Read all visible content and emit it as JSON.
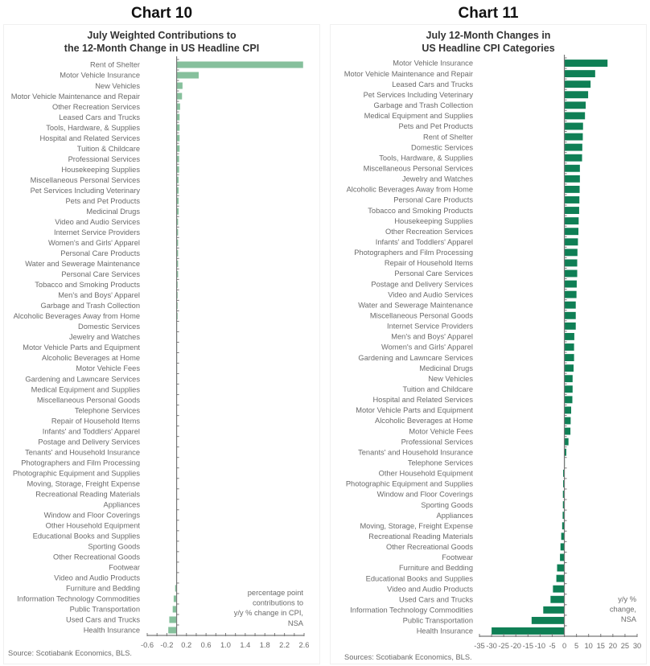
{
  "chart_data": [
    {
      "id": "chart10",
      "chart_number": "Chart 10",
      "type": "bar",
      "orientation": "horizontal",
      "title": "July Weighted Contributions to the 12-Month Change in US Headline CPI",
      "title_lines": [
        "July Weighted Contributions to",
        "the 12-Month Change in US Headline CPI"
      ],
      "note_lines": [
        "percentage point",
        "contributions to",
        "y/y % change in CPI,",
        "NSA"
      ],
      "source": "Source: Scotiabank Economics, BLS.",
      "xlim": [
        -0.6,
        2.6
      ],
      "xticks": [
        -0.6,
        -0.2,
        0.2,
        0.6,
        1.0,
        1.4,
        1.8,
        2.2,
        2.6
      ],
      "xtick_labels": [
        "-0.6",
        "-0.2",
        "0.2",
        "0.6",
        "1.0",
        "1.4",
        "1.8",
        "2.2",
        "2.6"
      ],
      "minor_tick_step": 0.2,
      "bar_color": "#86c09c",
      "categories": [
        "Rent of Shelter",
        "Motor Vehicle Insurance",
        "New Vehicles",
        "Motor Vehicle Maintenance and Repair",
        "Other Recreation Services",
        "Leased Cars and Trucks",
        "Tools, Hardware, & Supplies",
        "Hospital and Related Services",
        "Tuition & Childcare",
        "Professional Services",
        "Housekeeping Supplies",
        "Miscellaneous Personal Services",
        "Pet Services Including Veterinary",
        "Pets and Pet Products",
        "Medicinal Drugs",
        "Video and Audio Services",
        "Internet Service Providers",
        "Women's and Girls' Apparel",
        "Personal Care Products",
        "Water and Sewerage Maintenance",
        "Personal Care Services",
        "Tobacco and Smoking Products",
        "Men's and Boys' Apparel",
        "Garbage and Trash Collection",
        "Alcoholic Beverages Away from Home",
        "Domestic Services",
        "Jewelry and Watches",
        "Motor Vehicle Parts and Equipment",
        "Alcoholic Beverages at Home",
        "Motor Vehicle Fees",
        "Gardening and Lawncare Services",
        "Medical Equipment and Supplies",
        "Miscellaneous Personal Goods",
        "Telephone Services",
        "Repair of Household Items",
        "Infants' and Toddlers' Apparel",
        "Postage and Delivery Services",
        "Tenants' and Household Insurance",
        "Photographers and Film Processing",
        "Photographic Equipment and Supplies",
        "Moving, Storage, Freight Expense",
        "Recreational Reading Materials",
        "Appliances",
        "Window and Floor Coverings",
        "Other Household Equipment",
        "Educational Books and Supplies",
        "Sporting Goods",
        "Other Recreational Goods",
        "Footwear",
        "Video and Audio Products",
        "Furniture and Bedding",
        "Information Technology Commodities",
        "Public Transportation",
        "Used Cars and Trucks",
        "Health Insurance"
      ],
      "values": [
        2.58,
        0.45,
        0.12,
        0.11,
        0.07,
        0.06,
        0.06,
        0.06,
        0.06,
        0.05,
        0.05,
        0.04,
        0.04,
        0.04,
        0.04,
        0.03,
        0.03,
        0.03,
        0.03,
        0.03,
        0.03,
        0.02,
        0.02,
        0.02,
        0.02,
        0.01,
        0.01,
        0.01,
        0.01,
        0.01,
        0.01,
        0.01,
        0.005,
        0.005,
        0.005,
        0.005,
        0.005,
        0.003,
        0.002,
        0.0,
        0.0,
        0.0,
        0.0,
        0.0,
        0.0,
        -0.002,
        -0.003,
        -0.004,
        -0.005,
        -0.01,
        -0.03,
        -0.06,
        -0.08,
        -0.15,
        -0.17
      ]
    },
    {
      "id": "chart11",
      "chart_number": "Chart 11",
      "type": "bar",
      "orientation": "horizontal",
      "title": "July 12-Month Changes in US Headline CPI Categories",
      "title_lines": [
        "July 12-Month Changes in",
        "US Headline CPI Categories"
      ],
      "note_lines": [
        "y/y %",
        "change,",
        "NSA"
      ],
      "source": "Sources: Scotiabank Economics, BLS.",
      "xlim": [
        -35,
        30
      ],
      "xticks": [
        -35,
        -30,
        -25,
        -20,
        -15,
        -10,
        -5,
        0,
        5,
        10,
        15,
        20,
        25,
        30
      ],
      "xtick_labels": [
        "-35",
        "-30",
        "-25",
        "-20",
        "-15",
        "-10",
        "-5",
        "0",
        "5",
        "10",
        "15",
        "20",
        "25",
        "30"
      ],
      "minor_tick_step": 5,
      "bar_color": "#0f7f55",
      "categories": [
        "Motor Vehicle Insurance",
        "Motor Vehicle Maintenance and Repair",
        "Leased Cars and Trucks",
        "Pet Services Including Veterinary",
        "Garbage and Trash Collection",
        "Medical Equipment and Supplies",
        "Pets and Pet Products",
        "Rent of Shelter",
        "Domestic Services",
        "Tools, Hardware, & Supplies",
        "Miscellaneous Personal Services",
        "Jewelry and Watches",
        "Alcoholic Beverages Away from Home",
        "Personal Care Products",
        "Tobacco and Smoking Products",
        "Housekeeping Supplies",
        "Other Recreation Services",
        "Infants' and Toddlers' Apparel",
        "Photographers and Film Processing",
        "Repair of Household Items",
        "Personal Care Services",
        "Postage and Delivery Services",
        "Video and Audio Services",
        "Water and Sewerage Maintenance",
        "Miscellaneous Personal Goods",
        "Internet Service Providers",
        "Men's and Boys' Apparel",
        "Women's and Girls' Apparel",
        "Gardening and Lawncare Services",
        "Medicinal Drugs",
        "New Vehicles",
        "Tuition and Childcare",
        "Hospital and Related Services",
        "Motor Vehicle Parts and Equipment",
        "Alcoholic Beverages at Home",
        "Motor Vehicle Fees",
        "Professional Services",
        "Tenants' and Household Insurance",
        "Telephone Services",
        "Other Household Equipment",
        "Photographic Equipment and Supplies",
        "Window and Floor Coverings",
        "Sporting Goods",
        "Appliances",
        "Moving, Storage, Freight Expense",
        "Recreational Reading Materials",
        "Other Recreational Goods",
        "Footwear",
        "Furniture and Bedding",
        "Educational Books and Supplies",
        "Video and Audio Products",
        "Used Cars and Trucks",
        "Information Technology Commodities",
        "Public Transportation",
        "Health Insurance"
      ],
      "values": [
        17.8,
        12.7,
        10.8,
        9.8,
        8.8,
        8.5,
        7.7,
        7.6,
        7.4,
        7.3,
        6.4,
        6.4,
        6.3,
        6.2,
        6.1,
        5.9,
        5.8,
        5.6,
        5.4,
        5.3,
        5.3,
        5.1,
        5.0,
        4.7,
        4.7,
        4.7,
        4.1,
        4.0,
        4.0,
        3.8,
        3.4,
        3.4,
        3.3,
        2.8,
        2.6,
        2.5,
        1.7,
        0.8,
        0.2,
        -0.5,
        -0.5,
        -0.6,
        -0.6,
        -0.7,
        -0.9,
        -1.3,
        -1.6,
        -1.8,
        -3.0,
        -3.3,
        -4.7,
        -5.7,
        -8.7,
        -13.5,
        -30.0
      ]
    }
  ]
}
